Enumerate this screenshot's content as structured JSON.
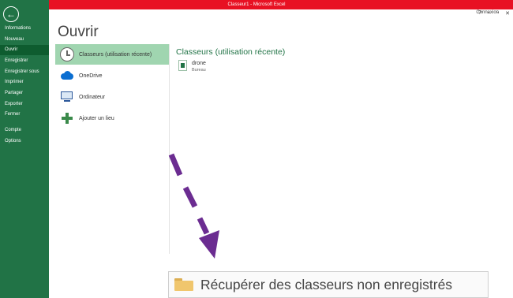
{
  "window": {
    "title": "Classeur1 -  Microsoft Excel",
    "controls": [
      "?",
      "–",
      "▫",
      "✕"
    ],
    "account_label": "Connexion"
  },
  "sidebar": {
    "back_glyph": "←",
    "items": [
      {
        "label": "Informations",
        "active": false
      },
      {
        "label": "Nouveau",
        "active": false
      },
      {
        "label": "Ouvrir",
        "active": true
      },
      {
        "label": "Enregistrer",
        "active": false
      },
      {
        "label": "Enregistrer sous",
        "active": false
      },
      {
        "label": "Imprimer",
        "active": false
      },
      {
        "label": "Partager",
        "active": false
      },
      {
        "label": "Exporter",
        "active": false
      },
      {
        "label": "Fermer",
        "active": false
      },
      {
        "label": "Compte",
        "active": false
      },
      {
        "label": "Options",
        "active": false
      }
    ]
  },
  "main": {
    "title": "Ouvrir",
    "places": [
      {
        "label": "Classeurs (utilisation récente)",
        "icon": "clock-icon",
        "active": true
      },
      {
        "label": "OneDrive",
        "icon": "cloud-icon",
        "active": false
      },
      {
        "label": "Ordinateur",
        "icon": "computer-icon",
        "active": false
      },
      {
        "label": "Ajouter un lieu",
        "icon": "plus-icon",
        "active": false
      }
    ],
    "recent": {
      "title": "Classeurs (utilisation récente)",
      "files": [
        {
          "name": "drone",
          "location": "Bureau"
        }
      ]
    },
    "recover_button": {
      "label": "Récupérer des classeurs non enregistrés",
      "icon": "folder-icon"
    }
  },
  "colors": {
    "titlebar": "#e81123",
    "sidebar": "#217346",
    "sidebar_active": "#0e5c2f",
    "place_active": "#a0d5b0",
    "accent_text": "#217346",
    "annotation_arrow": "#6b2c91"
  }
}
